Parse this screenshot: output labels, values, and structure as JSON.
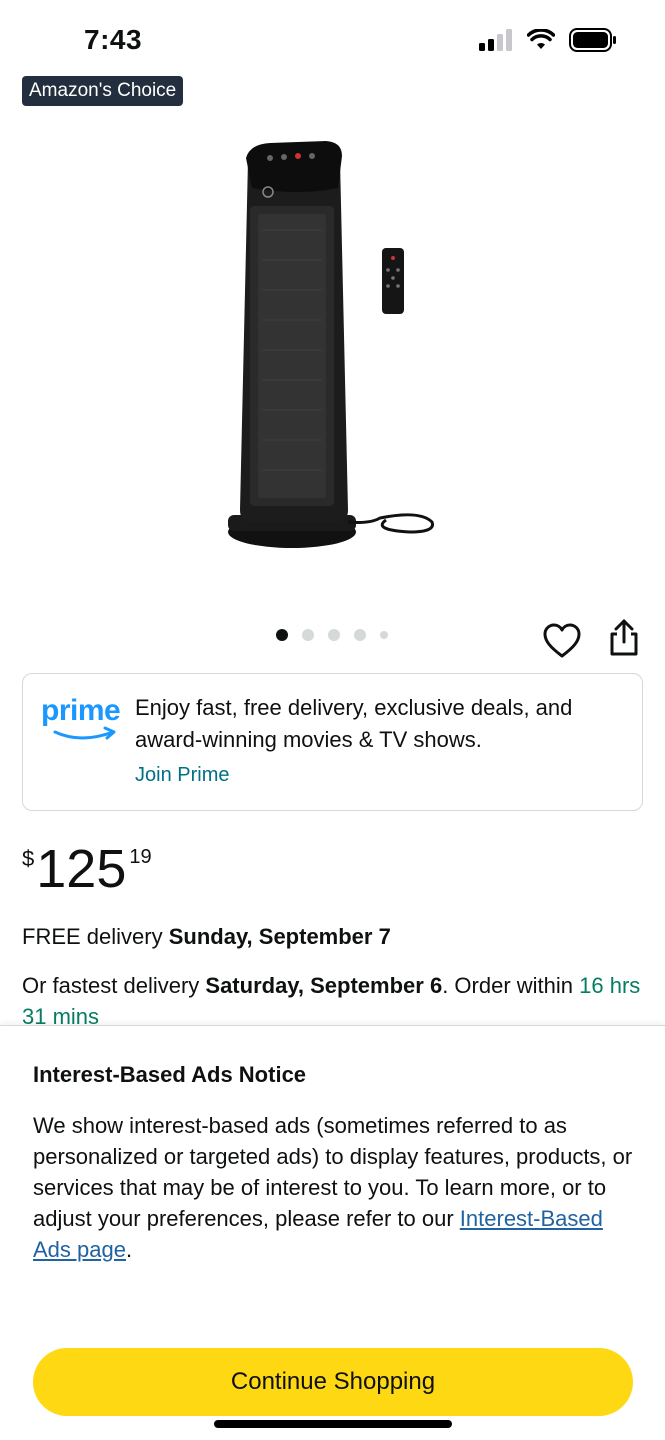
{
  "status_bar": {
    "time": "7:43",
    "signal_icon": "cellular-signal-icon",
    "wifi_icon": "wifi-icon",
    "battery_icon": "battery-icon"
  },
  "product": {
    "badge": "Amazon's Choice",
    "image_icon": "tower-heater-product-image",
    "carousel": {
      "count": 5,
      "active_index": 0
    },
    "wishlist_icon": "heart-icon",
    "share_icon": "share-icon"
  },
  "prime": {
    "logo_text": "prime",
    "message": "Enjoy fast, free delivery, exclusive deals, and award-winning movies & TV shows.",
    "link": "Join Prime"
  },
  "price": {
    "symbol": "$",
    "whole": "125",
    "fraction": "19"
  },
  "delivery": {
    "free_prefix": "FREE delivery ",
    "free_date": "Sunday, September 7",
    "fastest_prefix": "Or fastest delivery ",
    "fastest_date": "Saturday, September 6",
    "order_within": ". Order within ",
    "countdown": "16 hrs 31 mins"
  },
  "notice": {
    "title": "Interest-Based Ads Notice",
    "body": "We show interest-based ads (sometimes referred to as personalized or targeted ads) to display features, products, or services that may be of interest to you. To learn more, or to adjust your preferences, please refer to our ",
    "link": "Interest-Based Ads page",
    "body_end": ".",
    "button": "Continue Shopping"
  },
  "colors": {
    "badge_bg": "#232f3e",
    "prime_blue": "#1a98ff",
    "link": "#007185",
    "countdown": "#067d62",
    "button": "#ffd814"
  }
}
